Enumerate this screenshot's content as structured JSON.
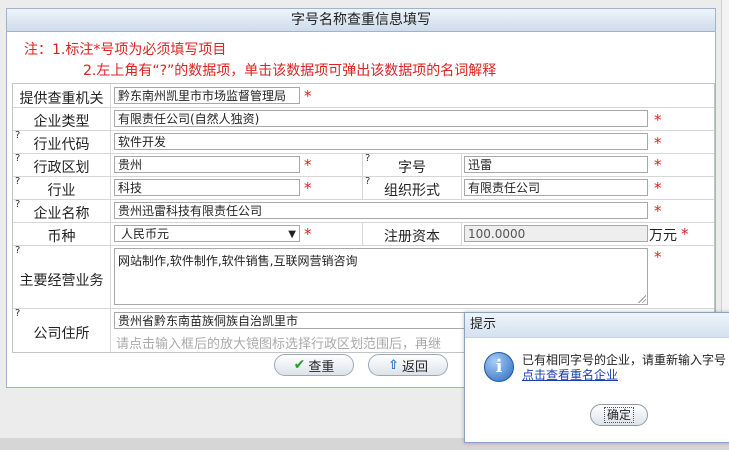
{
  "header": {
    "title": "字号名称查重信息填写"
  },
  "notes": {
    "line1": "注：1.标注*号项为必须填写项目",
    "line2": "2.左上角有“?”的数据项，单击该数据项可弹出该数据项的名词解释"
  },
  "required_mark": "*",
  "help_mark": "?",
  "form": {
    "agency_label": "提供查重机关",
    "agency_value": "黔东南州凯里市市场监督管理局",
    "company_type_label": "企业类型",
    "company_type_value": "有限责任公司(自然人独资)",
    "industry_code_label": "行业代码",
    "industry_code_value": "软件开发",
    "district_label": "行政区划",
    "district_value": "贵州",
    "trade_name_label": "字号",
    "trade_name_value": "迅雷",
    "industry_label": "行业",
    "industry_value": "科技",
    "org_form_label": "组织形式",
    "org_form_value": "有限责任公司",
    "company_name_label": "企业名称",
    "company_name_value": "贵州迅雷科技有限责任公司",
    "currency_label": "币种",
    "currency_value": "人民币元",
    "capital_label": "注册资本",
    "capital_value": "100.0000",
    "capital_unit": "万元",
    "business_label": "主要经营业务",
    "business_value": "网站制作,软件制作,软件销售,互联网营销咨询",
    "address_label": "公司住所",
    "address_value": "贵州省黔东南苗族侗族自治凯里市",
    "address_hint": "请点击输入框后的放大镜图标选择行政区划范围后，再继"
  },
  "buttons": {
    "check": "查重",
    "back": "返回"
  },
  "dialog": {
    "title": "提示",
    "message": "已有相同字号的企业，请重新输入字号",
    "link": "点击查看重名企业",
    "ok": "确定"
  },
  "colors": {
    "required": "#dd2222",
    "note": "#dd2222",
    "link": "#1a3fb0",
    "border": "#9fb4cc"
  },
  "icons": {
    "check": "check-icon",
    "back": "up-arrow-icon",
    "info": "info-icon",
    "select": "triangle-down-icon"
  }
}
